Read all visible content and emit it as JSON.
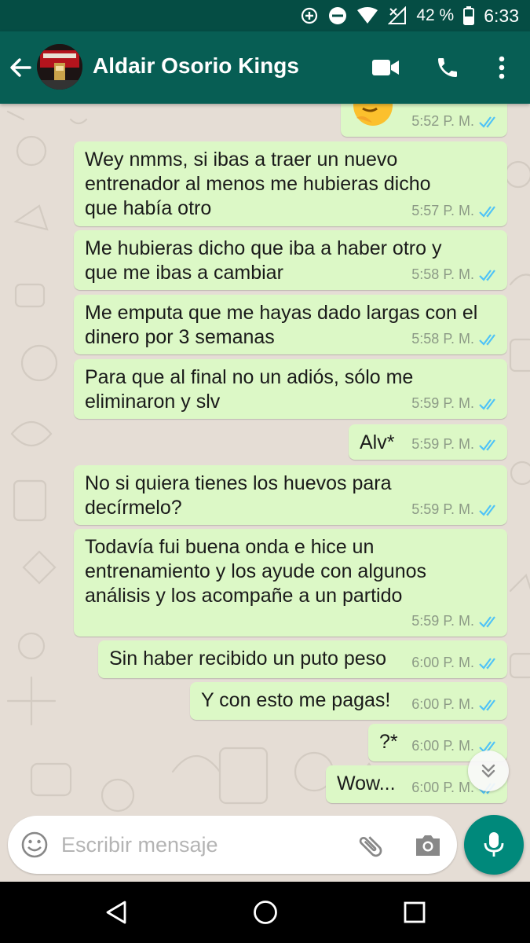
{
  "status_bar": {
    "battery": "42 %",
    "time": "6:33",
    "icons": [
      "data-saver-icon",
      "do-not-disturb-icon",
      "wifi-icon",
      "no-signal-icon",
      "battery-icon"
    ]
  },
  "header": {
    "contact_name": "Aldair Osorio Kings",
    "icons": [
      "back-arrow-icon",
      "video-call-icon",
      "phone-icon",
      "more-vert-icon"
    ]
  },
  "messages": [
    {
      "text": "",
      "time": "5:52 P. M.",
      "emoji": "thinking-face-emoji",
      "status": "read"
    },
    {
      "lines": [
        "Wey nmms, si ibas a traer un nuevo",
        "entrenador al menos me hubieras dicho",
        "que había otro"
      ],
      "time": "5:57 P. M.",
      "status": "read"
    },
    {
      "lines": [
        "Me hubieras dicho que iba a haber otro y",
        "que me ibas a cambiar"
      ],
      "time": "5:58 P. M.",
      "status": "read"
    },
    {
      "lines": [
        "Me emputa que me hayas dado largas con el",
        "dinero por 3 semanas"
      ],
      "time": "5:58 P. M.",
      "status": "read"
    },
    {
      "lines": [
        "Para que al final no un adiós, sólo me",
        "eliminaron y slv"
      ],
      "time": "5:59 P. M.",
      "status": "read"
    },
    {
      "lines": [
        "Alv*"
      ],
      "time": "5:59 P. M.",
      "status": "read"
    },
    {
      "lines": [
        "No si quiera tienes los huevos para",
        "decírmelo?"
      ],
      "time": "5:59 P. M.",
      "status": "read"
    },
    {
      "lines": [
        "Todavía fui buena onda e hice un",
        "entrenamiento y los ayude con algunos",
        "análisis y los acompañe a un partido"
      ],
      "time": "5:59 P. M.",
      "status": "read"
    },
    {
      "lines": [
        "Sin haber recibido un puto peso"
      ],
      "time": "6:00 P. M.",
      "status": "read"
    },
    {
      "lines": [
        "Y con esto me pagas!"
      ],
      "time": "6:00 P. M.",
      "status": "read"
    },
    {
      "lines": [
        "?*"
      ],
      "time": "6:00 P. M.",
      "status": "read"
    },
    {
      "lines": [
        "Wow..."
      ],
      "time": "6:00 P. M.",
      "status": "read"
    }
  ],
  "composer": {
    "placeholder": "Escribir mensaje",
    "icons": [
      "emoji-icon",
      "attach-icon",
      "camera-icon",
      "mic-icon"
    ]
  },
  "scroll_down": {
    "icon": "double-chevron-down-icon"
  },
  "nav_bar": {
    "icons": [
      "back-triangle-icon",
      "home-circle-icon",
      "recents-square-icon"
    ]
  },
  "colors": {
    "status_bar": "#054d44",
    "app_bar": "#075e54",
    "chat_bg": "#e5ddd5",
    "bubble_out": "#dcf8c6",
    "read_tick": "#4fc3f7",
    "fab": "#00897b"
  }
}
